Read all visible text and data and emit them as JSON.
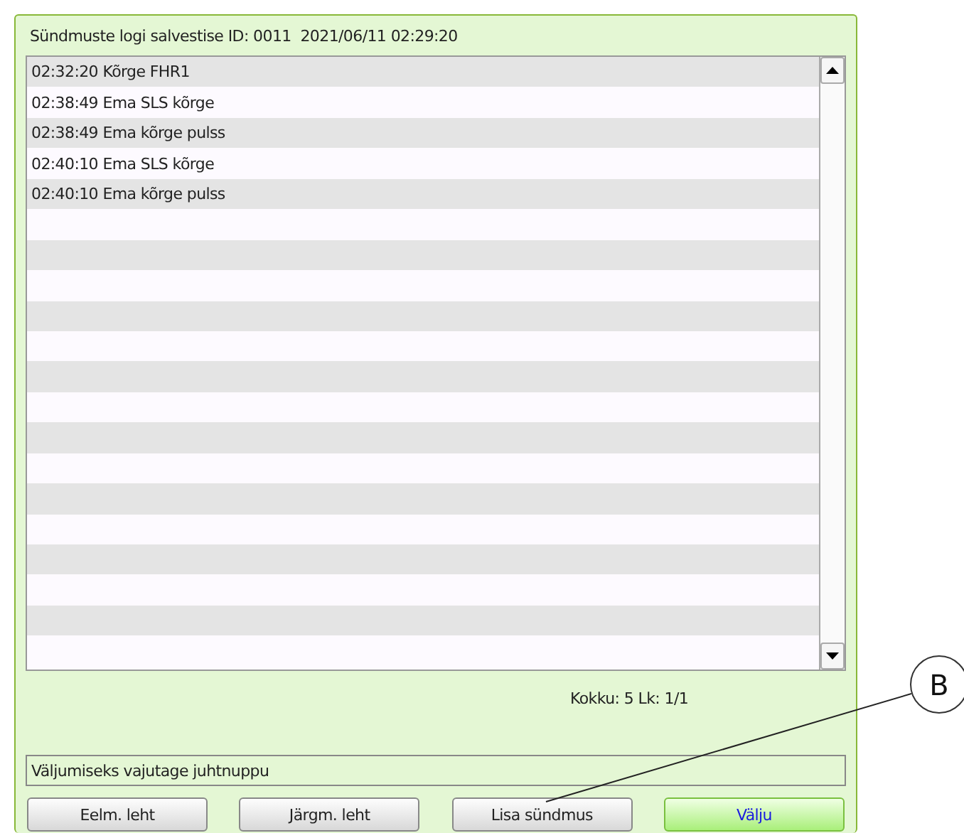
{
  "panel": {
    "title": "Sündmuste logi salvestise ID: 0011  2021/06/11 02:29:20"
  },
  "events": [
    {
      "text": "02:32:20 Kõrge FHR1"
    },
    {
      "text": "02:38:49 Ema SLS kõrge"
    },
    {
      "text": "02:38:49 Ema kõrge pulss"
    },
    {
      "text": "02:40:10 Ema SLS kõrge"
    },
    {
      "text": "02:40:10 Ema kõrge pulss"
    }
  ],
  "summary": "Kokku: 5 Lk: 1/1",
  "status_message": "Väljumiseks vajutage juhtnuppu",
  "buttons": [
    {
      "label": "Eelm. leht",
      "primary": false
    },
    {
      "label": "Järgm. leht",
      "primary": false
    },
    {
      "label": "Lisa sündmus",
      "primary": false
    },
    {
      "label": "Välju",
      "primary": true
    }
  ],
  "callout": {
    "label": "B"
  }
}
